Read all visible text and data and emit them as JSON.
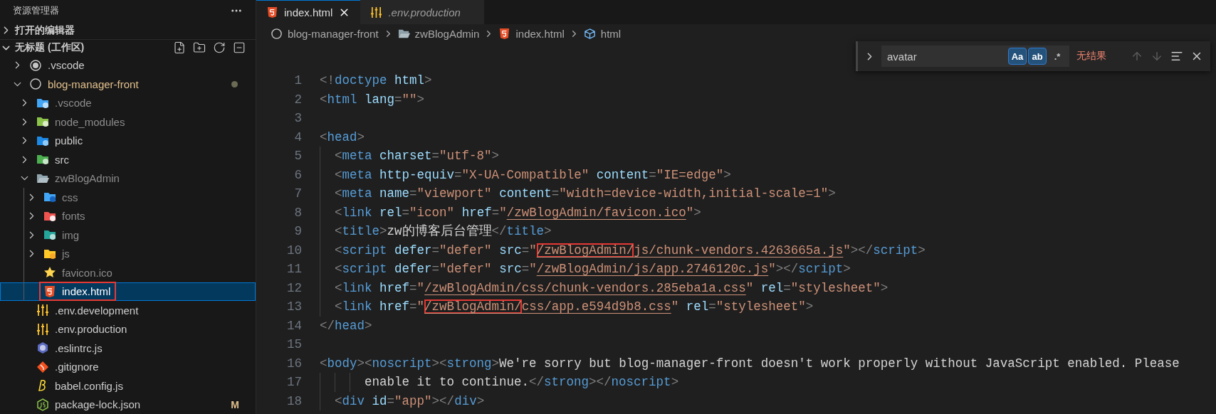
{
  "sidebar": {
    "title": "资源管理器",
    "open_editors": {
      "label": "打开的编辑器",
      "expanded": false
    },
    "workspace": {
      "label": "无标题 (工作区)",
      "expanded": true,
      "items": [
        {
          "name": ".vscode",
          "kind": "root-settings",
          "expanded": false,
          "selected": false,
          "ignored": false,
          "modified": false,
          "highlighted": false
        },
        {
          "name": "blog-manager-front",
          "kind": "root",
          "expanded": true,
          "selected": false,
          "ignored": false,
          "modified": true,
          "highlighted": false,
          "children": [
            {
              "name": ".vscode",
              "kind": "folder-vscode",
              "expanded": false,
              "selected": false,
              "ignored": true,
              "modified": false,
              "highlighted": false
            },
            {
              "name": "node_modules",
              "kind": "folder-node",
              "expanded": false,
              "selected": false,
              "ignored": true,
              "modified": false,
              "highlighted": false
            },
            {
              "name": "public",
              "kind": "folder-public",
              "expanded": false,
              "selected": false,
              "ignored": false,
              "modified": false,
              "highlighted": false
            },
            {
              "name": "src",
              "kind": "folder-src",
              "expanded": false,
              "selected": false,
              "ignored": false,
              "modified": false,
              "highlighted": false
            },
            {
              "name": "zwBlogAdmin",
              "kind": "folder",
              "expanded": true,
              "selected": false,
              "ignored": true,
              "modified": false,
              "highlighted": false,
              "children": [
                {
                  "name": "css",
                  "kind": "folder-css",
                  "expanded": false,
                  "selected": false,
                  "ignored": true,
                  "modified": false,
                  "highlighted": false
                },
                {
                  "name": "fonts",
                  "kind": "folder-fonts",
                  "expanded": false,
                  "selected": false,
                  "ignored": true,
                  "modified": false,
                  "highlighted": false
                },
                {
                  "name": "img",
                  "kind": "folder-img",
                  "expanded": false,
                  "selected": false,
                  "ignored": true,
                  "modified": false,
                  "highlighted": false
                },
                {
                  "name": "js",
                  "kind": "folder-js",
                  "expanded": false,
                  "selected": false,
                  "ignored": true,
                  "modified": false,
                  "highlighted": false
                },
                {
                  "name": "favicon.ico",
                  "kind": "ico",
                  "selected": false,
                  "ignored": true,
                  "modified": false,
                  "highlighted": false
                },
                {
                  "name": "index.html",
                  "kind": "html",
                  "selected": true,
                  "ignored": false,
                  "modified": false,
                  "highlighted": true
                }
              ]
            },
            {
              "name": ".env.development",
              "kind": "env",
              "selected": false,
              "ignored": false,
              "modified": false,
              "highlighted": false
            },
            {
              "name": ".env.production",
              "kind": "env",
              "selected": false,
              "ignored": false,
              "modified": false,
              "highlighted": false
            },
            {
              "name": ".eslintrc.js",
              "kind": "eslint",
              "selected": false,
              "ignored": false,
              "modified": false,
              "highlighted": false
            },
            {
              "name": ".gitignore",
              "kind": "git",
              "selected": false,
              "ignored": false,
              "modified": false,
              "highlighted": false
            },
            {
              "name": "babel.config.js",
              "kind": "babel",
              "selected": false,
              "ignored": false,
              "modified": false,
              "highlighted": false
            },
            {
              "name": "package-lock.json",
              "kind": "json",
              "selected": false,
              "ignored": false,
              "modified": false,
              "highlighted": false,
              "badge": "M"
            }
          ]
        }
      ]
    }
  },
  "tabs": [
    {
      "label": "index.html",
      "kind": "html",
      "selected": true,
      "preview": false
    },
    {
      "label": ".env.production",
      "kind": "env",
      "selected": false,
      "preview": true
    }
  ],
  "breadcrumbs": [
    {
      "label": "blog-manager-front",
      "kind": "root"
    },
    {
      "label": "zwBlogAdmin",
      "kind": "folder"
    },
    {
      "label": "index.html",
      "kind": "html"
    },
    {
      "label": "html",
      "kind": "element"
    }
  ],
  "find": {
    "replace_expanded": false,
    "value": "avatar",
    "options": [
      {
        "label": "Aa",
        "on": true
      },
      {
        "label": "ab",
        "on": true
      },
      {
        "label": ".*",
        "on": false
      }
    ],
    "message": "无结果",
    "prev_disabled": true,
    "next_disabled": true
  },
  "code": [
    {
      "number": "1",
      "segments": [
        {
          "text": "<!doctype html>",
          "boxed": false
        }
      ]
    },
    {
      "number": "2",
      "segments": [
        {
          "text": "<html lang=\"\">",
          "boxed": false
        }
      ]
    },
    {
      "number": "3"
    },
    {
      "number": "4",
      "segments": [
        {
          "text": "<head>",
          "boxed": false
        }
      ]
    },
    {
      "number": "5",
      "segments": [
        {
          "text": "  <meta charset=\"utf-8\">",
          "boxed": false
        }
      ]
    },
    {
      "number": "6",
      "segments": [
        {
          "text": "  <meta http-equiv=\"X-UA-Compatible\" content=\"IE=edge\">",
          "boxed": false
        }
      ]
    },
    {
      "number": "7",
      "segments": [
        {
          "text": "  <meta name=\"viewport\" content=\"width=device-width,initial-scale=1\">",
          "boxed": false
        }
      ]
    },
    {
      "number": "8",
      "segments": [
        {
          "text": "  <link rel=\"icon\" href=\"/zwBlogAdmin/favicon.ico\">",
          "boxed": false
        }
      ]
    },
    {
      "number": "9",
      "segments": [
        {
          "text": "  <title>zw的博客后台管理</title>",
          "boxed": false
        }
      ]
    },
    {
      "number": "10",
      "segments": [
        {
          "text": "  <script defer=\"defer\" src=\"",
          "boxed": false
        },
        {
          "text": "/zwBlogAdmin/",
          "boxed": true
        },
        {
          "text": "js/chunk-vendors.4263665a.js\"></script>",
          "boxed": false
        }
      ]
    },
    {
      "number": "11",
      "segments": [
        {
          "text": "  <script defer=\"defer\" src=\"/zwBlogAdmin/js/app.2746120c.js\"></script>",
          "boxed": false
        }
      ]
    },
    {
      "number": "12",
      "segments": [
        {
          "text": "  <link href=\"/zwBlogAdmin/css/chunk-vendors.285eba1a.css\" rel=\"stylesheet\">",
          "boxed": false
        }
      ]
    },
    {
      "number": "13",
      "segments": [
        {
          "text": "  <link href=\"",
          "boxed": false
        },
        {
          "text": "/zwBlogAdmin/",
          "boxed": true
        },
        {
          "text": "css/app.e594d9b8.css\" rel=\"stylesheet\">",
          "boxed": false
        }
      ]
    },
    {
      "number": "14",
      "segments": [
        {
          "text": "</head>",
          "boxed": false
        }
      ]
    },
    {
      "number": "15"
    },
    {
      "number": "16",
      "segments": [
        {
          "text": "<body><noscript><strong>We're sorry but blog-manager-front doesn't work properly without JavaScript enabled. Please",
          "boxed": false
        }
      ]
    },
    {
      "number": "17",
      "segments": [
        {
          "text": "      enable it to continue.</strong></noscript>",
          "boxed": false
        }
      ]
    },
    {
      "number": "18",
      "segments": [
        {
          "text": "  <div id=\"app\"></div>",
          "boxed": false
        }
      ]
    }
  ]
}
